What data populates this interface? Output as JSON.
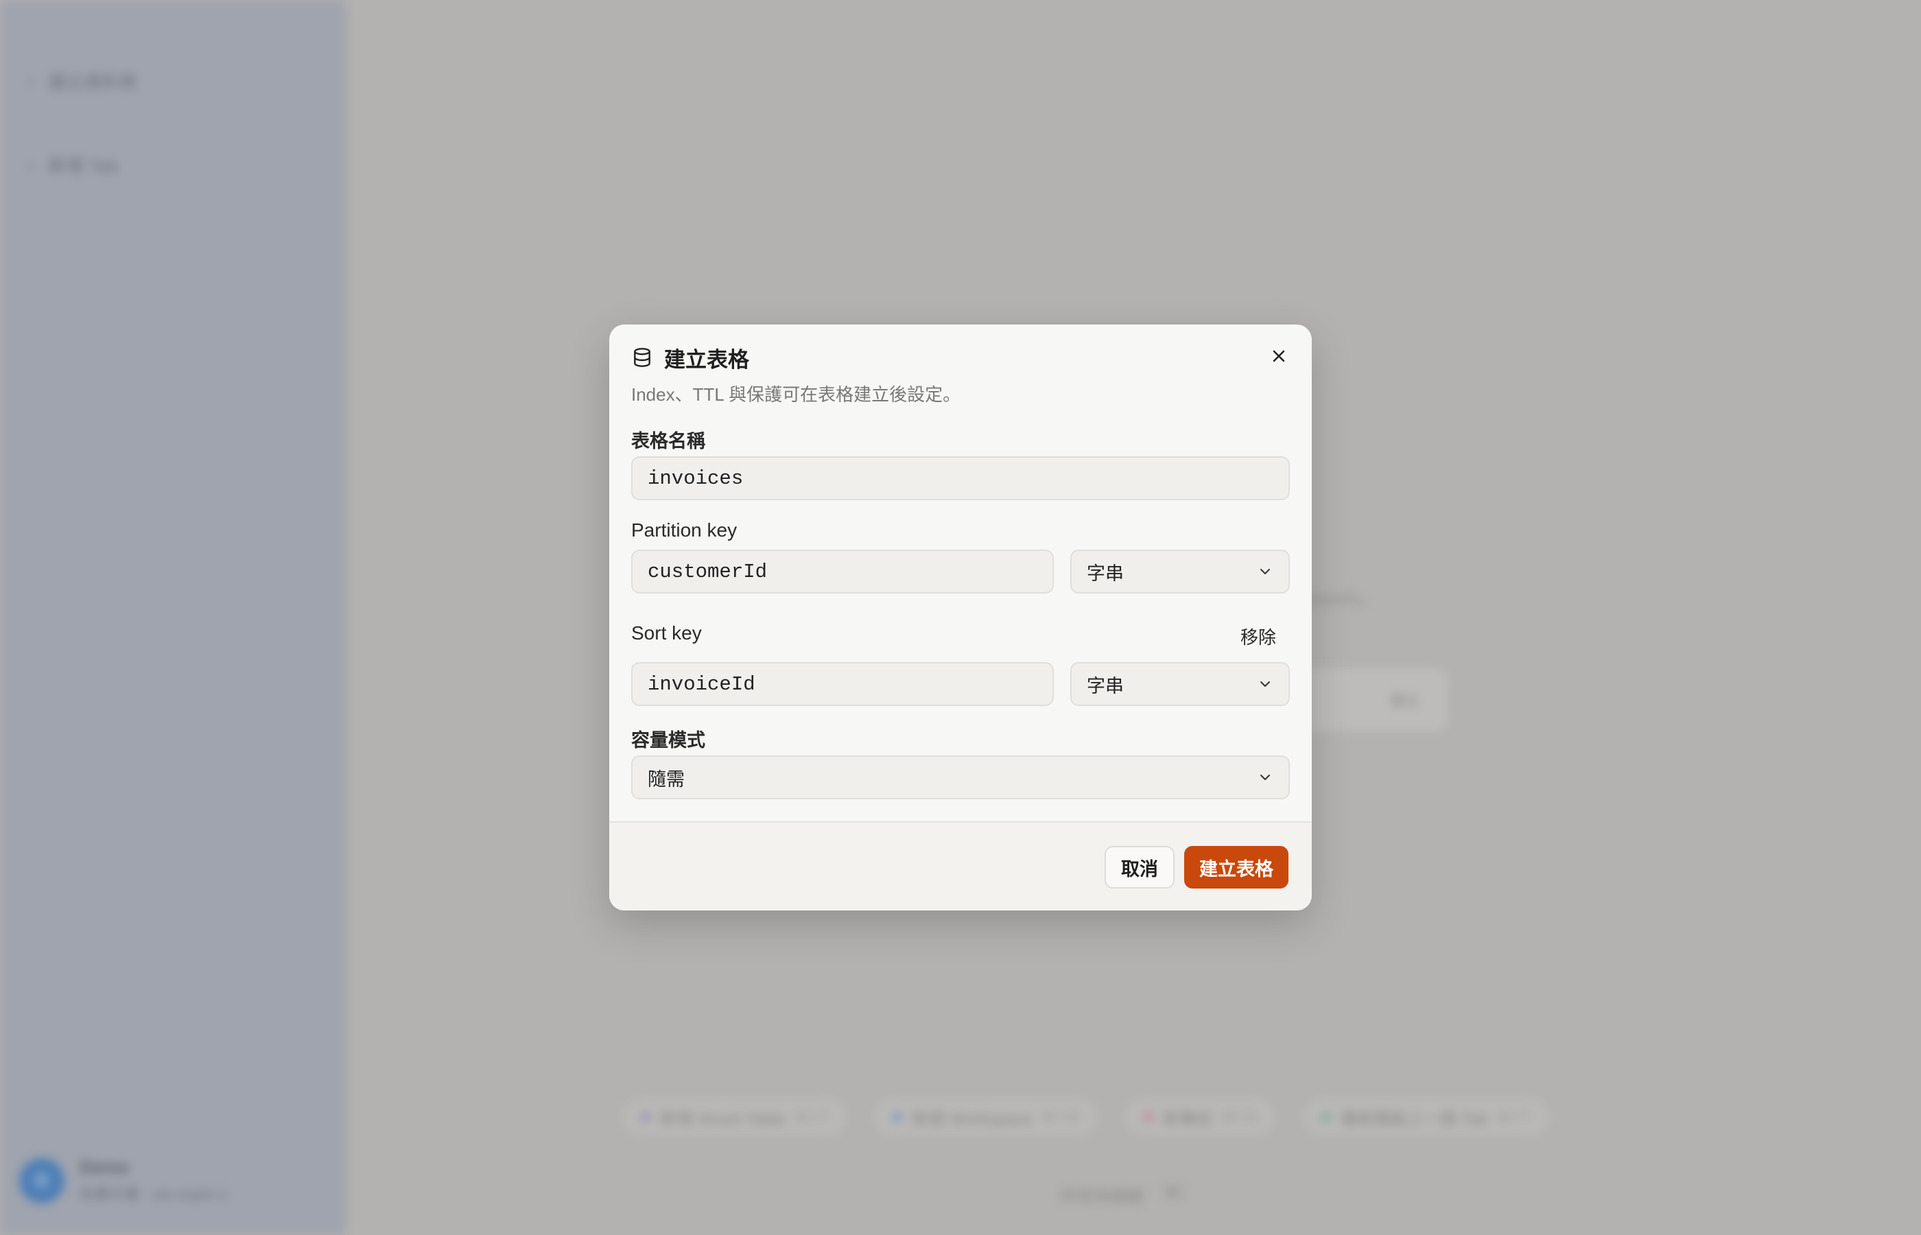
{
  "background": {
    "sidebar": {
      "items": [
        {
          "label": "建立資料表"
        },
        {
          "label": "新增 Tab"
        }
      ],
      "user": {
        "initial": "D",
        "name": "Demo",
        "subtitle": "免費方案 · ws-super-1"
      }
    },
    "main": {
      "hint_text": "Smart Table、Workspace 或 Launch。",
      "card_button": "建立",
      "quick_actions": [
        {
          "label": "新增 Smart Table",
          "shortcut": "⌘⇧T",
          "color": "#9a8fc0"
        },
        {
          "label": "新增 Workspace",
          "shortcut": "⌘⇧W",
          "color": "#7d97c8"
        },
        {
          "label": "新筆記",
          "shortcut": "⌘⇧N",
          "color": "#c48a94"
        },
        {
          "label": "重新開啟上一個 Tab",
          "shortcut": "⌘⇧T",
          "color": "#7fae9c"
        }
      ],
      "footer": {
        "label": "所有快捷鍵",
        "shortcut": "⌘/"
      }
    }
  },
  "modal": {
    "title": "建立表格",
    "subtitle": "Index、TTL 與保護可在表格建立後設定。",
    "icon": "database-icon",
    "table_name": {
      "label": "表格名稱",
      "value": "invoices"
    },
    "partition_key": {
      "label": "Partition key",
      "value": "customerId",
      "type": "字串"
    },
    "sort_key": {
      "label": "Sort key",
      "value": "invoiceId",
      "type": "字串",
      "remove_label": "移除"
    },
    "capacity_mode": {
      "label": "容量模式",
      "value": "隨需"
    },
    "cancel_label": "取消",
    "create_label": "建立表格",
    "accent_color": "#c9480b"
  }
}
